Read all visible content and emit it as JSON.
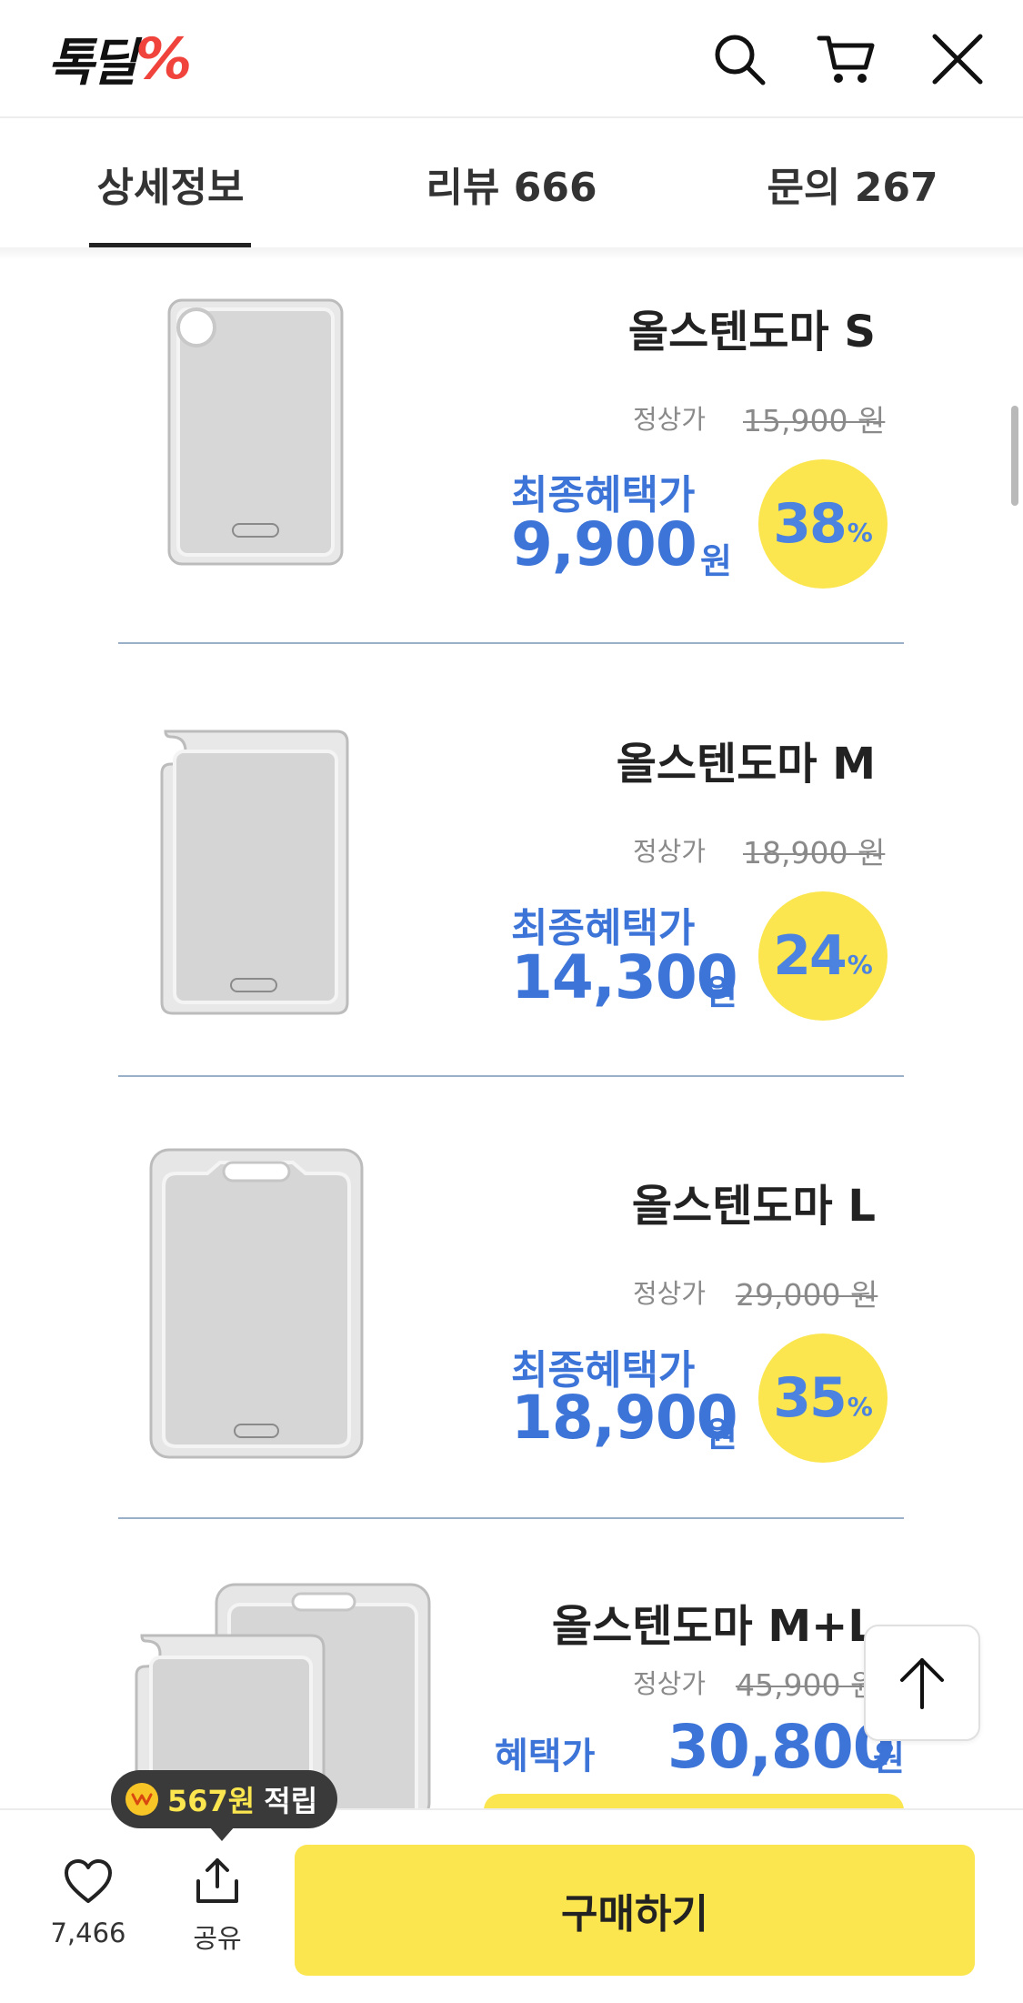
{
  "header": {
    "logo_text": "톡딜",
    "logo_mark": "%",
    "icons": [
      "search-icon",
      "cart-icon",
      "close-icon"
    ]
  },
  "tabs": [
    {
      "label": "상세정보",
      "active": true
    },
    {
      "label": "리뷰 666",
      "active": false
    },
    {
      "label": "문의 267",
      "active": false
    }
  ],
  "products": [
    {
      "name": "올스텐도마 S",
      "regular_label": "정상가",
      "regular_price": "15,900 원",
      "final_label": "최종혜택가",
      "final_price": "9,900",
      "won": "원",
      "discount": "38",
      "pct": "%"
    },
    {
      "name": "올스텐도마 M",
      "regular_label": "정상가",
      "regular_price": "18,900 원",
      "final_label": "최종혜택가",
      "final_price": "14,300",
      "won": "원",
      "discount": "24",
      "pct": "%"
    },
    {
      "name": "올스텐도마 L",
      "regular_label": "정상가",
      "regular_price": "29,000 원",
      "final_label": "최종혜택가",
      "final_price": "18,900",
      "won": "원",
      "discount": "35",
      "pct": "%"
    },
    {
      "name": "올스텐도마 M+L",
      "regular_label": "정상가",
      "regular_price": "45,900 원",
      "final_label": "혜택가",
      "final_price": "30,800",
      "won": "원"
    }
  ],
  "bottom_bar": {
    "like_count": "7,466",
    "share_label": "공유",
    "buy_label": "구매하기"
  },
  "points": {
    "amount": "567원",
    "label": "적립"
  },
  "colors": {
    "accent_blue": "#3d74d8",
    "badge_yellow": "#fbe64f",
    "logo_red": "#f0433c"
  }
}
